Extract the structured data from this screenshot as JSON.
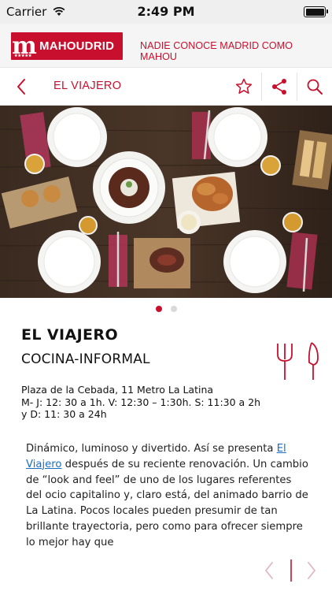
{
  "status": {
    "carrier": "Carrier",
    "time": "2:49 PM",
    "battery_level": 1.0
  },
  "brand": {
    "logo_letter": "m",
    "logo_text": "MAHOUDRID",
    "tagline": "NADIE CONOCE MADRID COMO MAHOU",
    "brand_color": "#c8102e"
  },
  "nav": {
    "title": "EL VIAJERO",
    "icons": [
      "chevron-left-icon",
      "star-icon",
      "share-icon",
      "search-icon"
    ]
  },
  "gallery": {
    "page_count": 2,
    "current_page": 1
  },
  "venue": {
    "name": "EL VIAJERO",
    "category": "COCINA-INFORMAL",
    "address_lines": [
      "Plaza de la Cebada, 11  Metro La Latina",
      "M- J: 12: 30  a 1h. V: 12:30 – 1:30h. S: 11:30  a 2h",
      "y  D: 11: 30 a 24h"
    ],
    "description_before_link": "Dinámico, luminoso y divertido. Así se presenta ",
    "description_link": "El Viajero",
    "description_after_link": " después de su reciente renovación. Un cambio de “look and feel” de uno de los lugares referentes del ocio capitalino y, claro está, del animado barrio de La Latina. Pocos locales pueden presumir de tan brillante trayectoria, pero como para ofrecer siempre lo mejor hay que",
    "link_color": "#1b6ec2"
  }
}
